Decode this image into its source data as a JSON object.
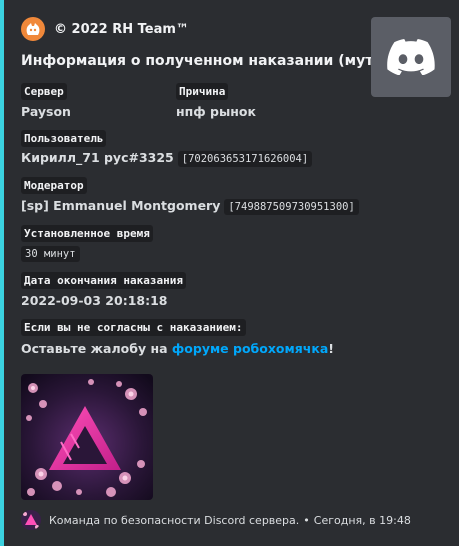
{
  "embed": {
    "accent_color": "#3bd2e0",
    "author": {
      "icon": "rh-team-logo-icon",
      "name": "© 2022 RH Team™"
    },
    "title": "Информация о полученном наказании (мут):",
    "thumbnail": {
      "icon": "discord-logo-icon"
    },
    "fields": {
      "server": {
        "name": "Сервер",
        "value": "Payson"
      },
      "reason": {
        "name": "Причина",
        "value": "нпф рынок"
      },
      "user": {
        "name": "Пользователь",
        "value": "Кирилл_71 рус#3325",
        "id": "[702063653171626004]"
      },
      "moderator": {
        "name": "Модератор",
        "value": "[sp] Emmanuel Montgomery",
        "id": "[749887509730951300]"
      },
      "duration": {
        "name": "Установленное время",
        "value": "30 минут"
      },
      "end_date": {
        "name": "Дата окончания наказания",
        "value": "2022-09-03 20:18:18"
      },
      "appeal": {
        "name": "Если вы не согласны с наказанием:",
        "prefix": "Оставьте жалобу на ",
        "link": "форуме робохомячка",
        "suffix": "!"
      }
    },
    "footer": {
      "icon": "rh-team-avatar-icon",
      "text": "Команда по безопасности Discord сервера.",
      "separator": "•",
      "timestamp": "Сегодня, в 19:48"
    }
  }
}
